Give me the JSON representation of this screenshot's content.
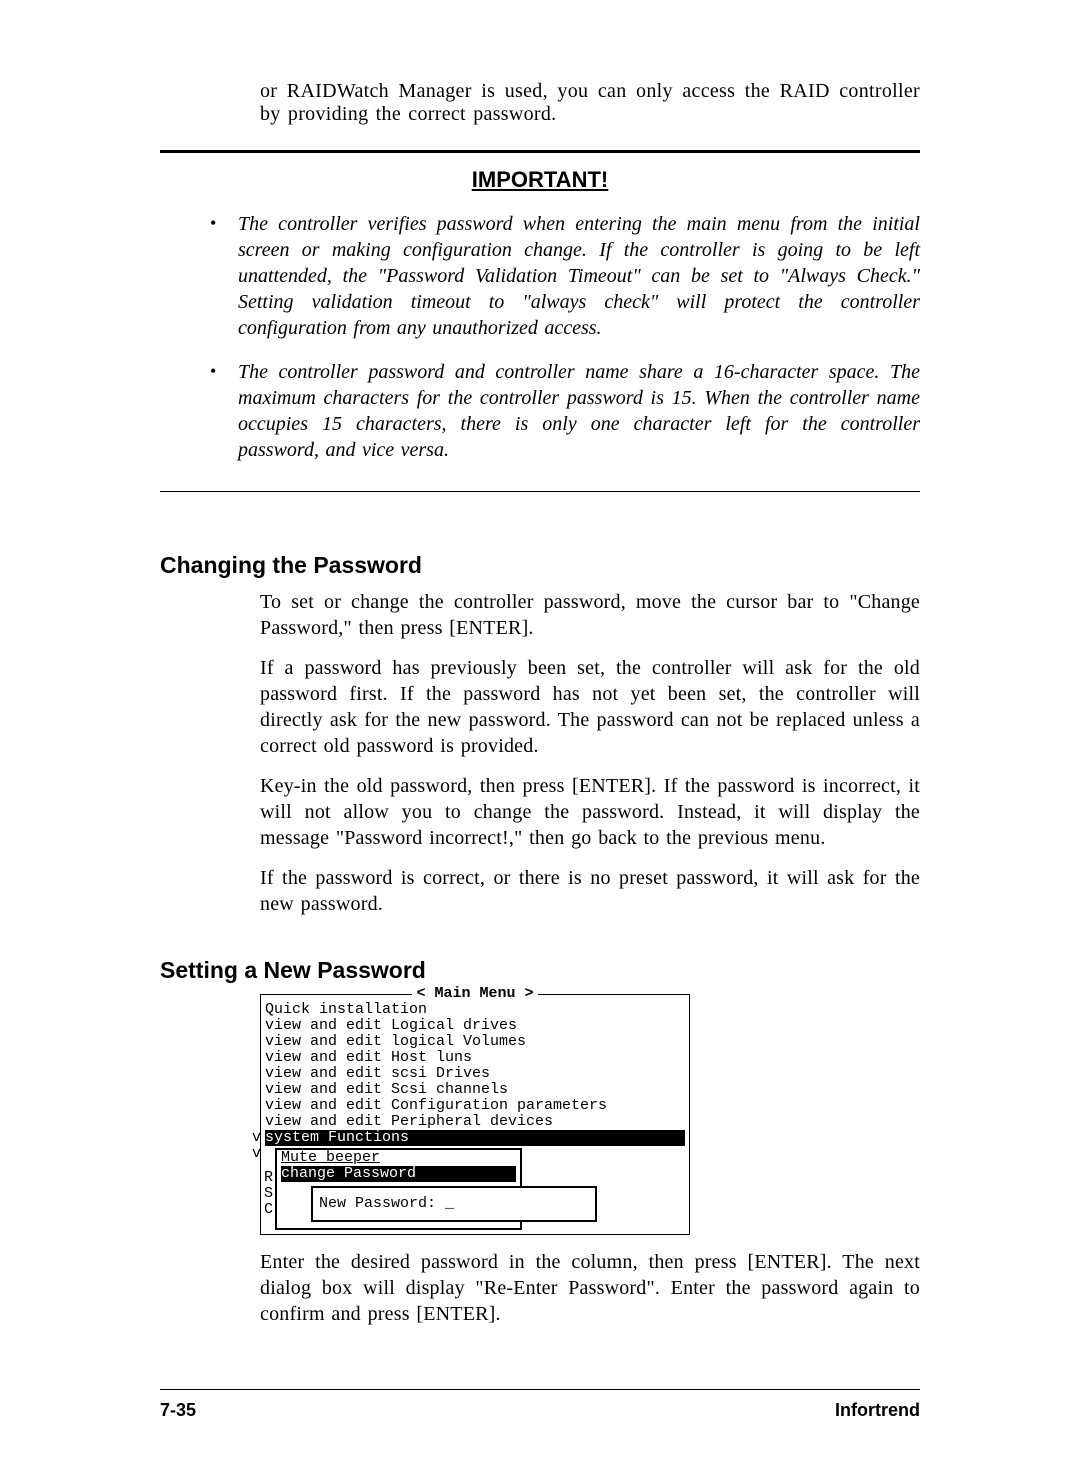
{
  "intro": "or RAIDWatch Manager is used, you can only access the RAID controller by providing the correct password.",
  "important": {
    "heading": "IMPORTANT!",
    "bullets": [
      "The controller verifies password when entering the main menu from the initial screen or making configuration change.  If the controller is going to be left unattended, the \"Password Validation Timeout\" can be set to \"Always Check.\"  Setting validation timeout to \"always check\" will protect the controller configuration from any unauthorized access.",
      "The controller password and controller name share a 16-character space.  The maximum characters for the controller password is 15.  When the controller name occupies 15 characters, there is only one character left for the controller password, and vice versa."
    ]
  },
  "section1": {
    "heading": "Changing the Password",
    "paras": [
      "To set or change the controller password, move the cursor bar to \"Change Password,\" then press [ENTER].",
      "If a password has previously been set, the controller will ask for the old password first. If the password has not yet been set, the controller will directly ask for the new password. The password can not be replaced unless a correct old password is provided.",
      "Key-in the old password, then press [ENTER].  If the password is incorrect, it will not allow you to change the password.  Instead, it will display the message \"Password incorrect!,\" then go back to the previous menu.",
      "If the password is correct, or there is no preset password, it will ask for the new password."
    ]
  },
  "section2": {
    "heading": "Setting a New Password",
    "terminal": {
      "title": "< Main Menu >",
      "lines": [
        "Quick installation",
        "view and edit Logical drives",
        "view and edit logical Volumes",
        "view and edit Host luns",
        "view and edit scsi Drives",
        "view and edit Scsi channels",
        "view and edit Configuration parameters",
        "view and edit Peripheral devices"
      ],
      "highlighted": "system Functions",
      "sub_mute": "Mute beeper",
      "sub_change": "change Password",
      "side1": "v\nv",
      "side2": "R\nS\nC",
      "pw_label": "New Password:  _"
    },
    "para_after": "Enter the desired password in the column, then press [ENTER]. The next dialog box will display \"Re-Enter Password\". Enter the password again to confirm and press [ENTER]."
  },
  "footer": {
    "page": "7-35",
    "brand": "Infortrend"
  }
}
